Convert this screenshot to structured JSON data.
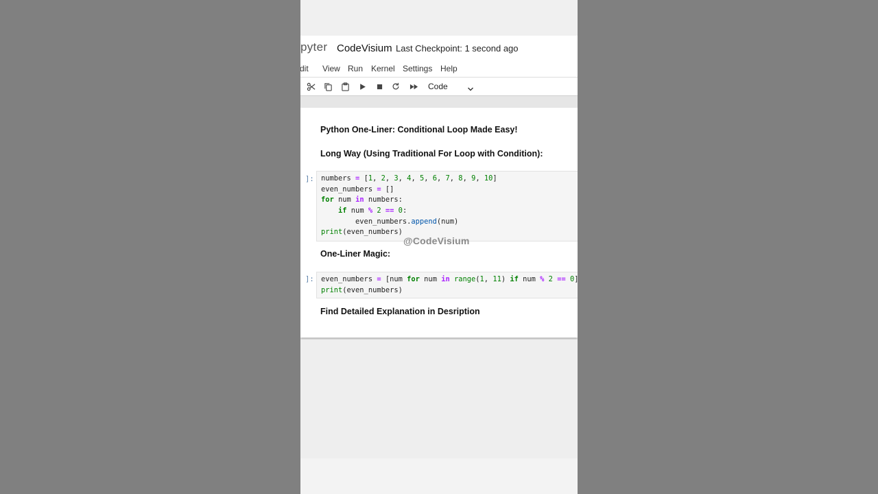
{
  "header": {
    "logo_text": "pyter",
    "notebook_title": "CodeVisium",
    "checkpoint": "Last Checkpoint: 1 second ago"
  },
  "menu": {
    "items": [
      {
        "label": "Edit",
        "visible_text": "dit"
      },
      {
        "label": "View"
      },
      {
        "label": "Run"
      },
      {
        "label": "Kernel"
      },
      {
        "label": "Settings"
      },
      {
        "label": "Help"
      }
    ]
  },
  "toolbar": {
    "icons": [
      "scissors-icon",
      "copy-icon",
      "paste-icon",
      "run-icon",
      "stop-icon",
      "restart-icon",
      "fast-forward-icon"
    ],
    "cell_type": "Code"
  },
  "notebook": {
    "heading_1": "Python One-Liner: Conditional Loop Made Easy!",
    "heading_2": "Long Way (Using Traditional For Loop with Condition):",
    "cell_1_prompt": "]:",
    "cell_1_lines": [
      "numbers = [1, 2, 3, 4, 5, 6, 7, 8, 9, 10]",
      "even_numbers = []",
      "for num in numbers:",
      "    if num % 2 == 0:",
      "        even_numbers.append(num)",
      "print(even_numbers)"
    ],
    "heading_3": "One-Liner Magic:",
    "cell_2_prompt": "]:",
    "cell_2_lines": [
      "even_numbers = [num for num in range(1, 11) if num % 2 == 0]",
      "print(even_numbers)"
    ],
    "heading_4": "Find Detailed Explanation in Desription"
  },
  "watermark": "@CodeVisium",
  "colors": {
    "keyword": "#008000",
    "operator": "#aa22ff",
    "function": "#0055aa",
    "prompt": "#5a7fa8",
    "cell_bg": "#f5f5f5"
  }
}
